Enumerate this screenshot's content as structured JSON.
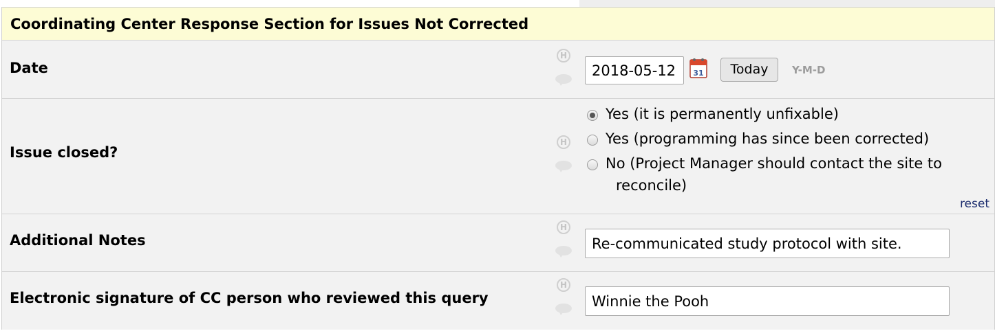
{
  "section_header": "Coordinating Center Response Section for Issues Not Corrected",
  "fields": {
    "date": {
      "label": "Date",
      "value": "2018-05-12",
      "today_label": "Today",
      "format_hint": "Y-M-D"
    },
    "issue_closed": {
      "label": "Issue closed?",
      "options": [
        {
          "label": "Yes (it is permanently unfixable)",
          "checked": true
        },
        {
          "label": "Yes (programming has since been corrected)",
          "checked": false
        },
        {
          "label_line1": "No (Project Manager should contact the site to",
          "label_line2": "reconcile)",
          "checked": false
        }
      ],
      "reset_label": "reset"
    },
    "additional_notes": {
      "label": "Additional Notes",
      "value": "Re-communicated study protocol with site."
    },
    "signature": {
      "label": "Electronic signature of CC person who reviewed this query",
      "value": "Winnie the Pooh"
    }
  },
  "icons": {
    "history": "history-icon",
    "comment": "comment-icon",
    "calendar": "calendar-icon"
  },
  "colors": {
    "header_bg": "#fdfcd5",
    "row_bg": "#f2f2f2",
    "link": "#1a2b6d"
  }
}
